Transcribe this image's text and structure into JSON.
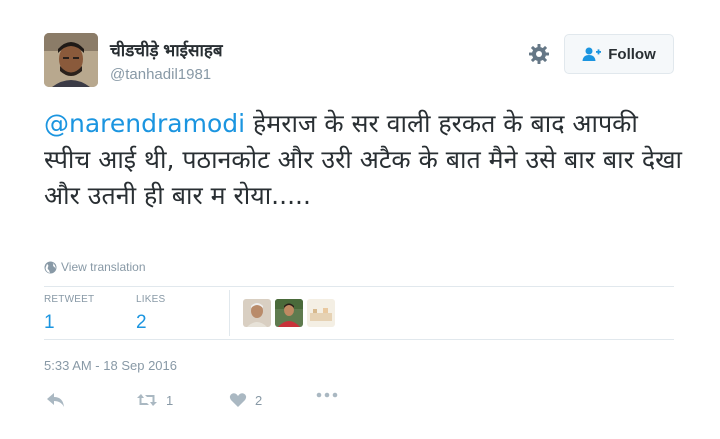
{
  "user": {
    "display_name": "चीडचीड़े भाईसाहब",
    "handle": "@tanhadil1981"
  },
  "header": {
    "follow_label": "Follow",
    "settings_icon": "gear-icon",
    "follow_icon": "add-user-icon"
  },
  "tweet": {
    "mention": "@narendramodi",
    "text": " हेमराज के सर वाली हरकत के बाद आपकी स्पीच आई थी, पठानकोट और उरी अटैक के बात मैने उसे बार बार देखा और उतनी ही बार म रोया....."
  },
  "translation": {
    "label": "View translation",
    "icon": "globe-icon"
  },
  "stats": {
    "retweets_label": "RETWEET",
    "retweets_value": "1",
    "likes_label": "LIKES",
    "likes_value": "2"
  },
  "timestamp": "5:33 AM - 18 Sep 2016",
  "actions": {
    "reply_icon": "reply-icon",
    "retweet_icon": "retweet-icon",
    "retweet_count": "1",
    "like_icon": "heart-icon",
    "like_count": "2",
    "more_icon": "more-icon"
  },
  "colors": {
    "accent": "#1b95e0",
    "muted": "#8899a6",
    "text": "#292f33",
    "border": "#e1e8ed"
  }
}
